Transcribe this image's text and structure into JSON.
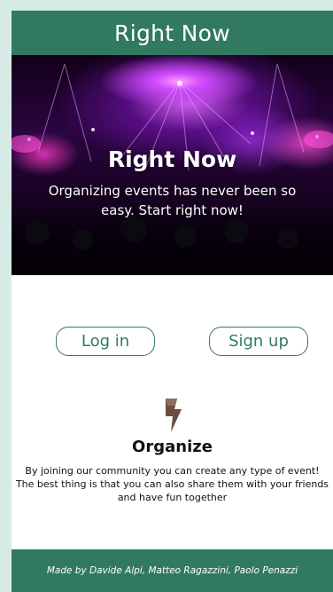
{
  "header": {
    "title": "Right Now"
  },
  "hero": {
    "title": "Right Now",
    "subtitle": "Organizing events has never been so easy. Start right now!"
  },
  "buttons": {
    "login": "Log in",
    "signup": "Sign up"
  },
  "feature": {
    "icon": "lightning-bolt-icon",
    "title": "Organize",
    "description": "By joining our community you can create any type of event! The best thing is that you can also share them with your friends and have fun together"
  },
  "footer": {
    "credits": "Made by Davide Alpi, Matteo Ragazzini, Paolo Penazzi"
  },
  "colors": {
    "brand": "#327a5f",
    "background": "#d7ebe6",
    "icon": "#6d4c41"
  }
}
